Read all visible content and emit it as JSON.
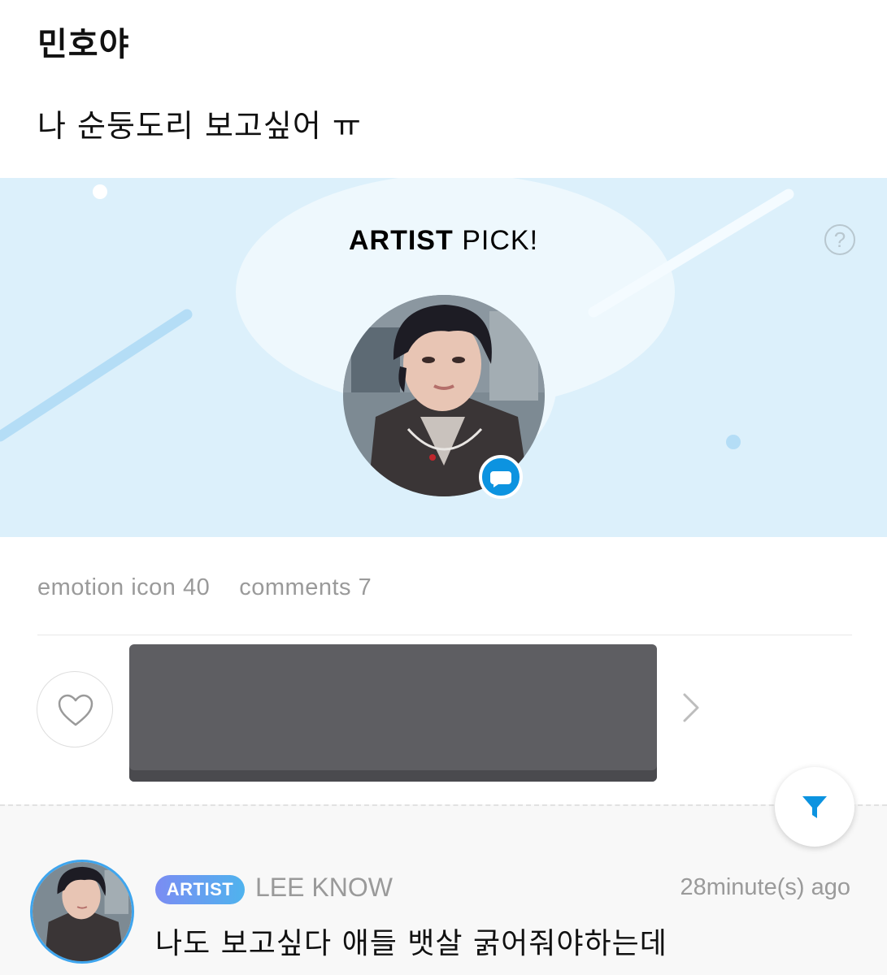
{
  "post": {
    "title": "민호야",
    "body": "나 순둥도리 보고싶어 ㅠ"
  },
  "artist_pick": {
    "title_bold": "ARTIST",
    "title_rest": " PICK!",
    "help_icon": "question-circle-icon",
    "help_glyph": "?",
    "avatar_icon": "artist-photo",
    "badge_icon": "chat-bubble-icon"
  },
  "stats": {
    "emotion": "emotion icon 40",
    "comments": "comments 7"
  },
  "actions": {
    "like_icon": "heart-icon",
    "next_icon": "chevron-right-icon",
    "filter_icon": "filter-icon"
  },
  "comment": {
    "badge": "ARTIST",
    "author": "LEE KNOW",
    "time": "28minute(s) ago",
    "text": "나도 보고싶다 애들 뱃살 굵어줘야하는데"
  },
  "colors": {
    "banner_bg": "#dcf0fb",
    "accent_blue": "#0c93e0",
    "muted_text": "#9a9a9a"
  }
}
